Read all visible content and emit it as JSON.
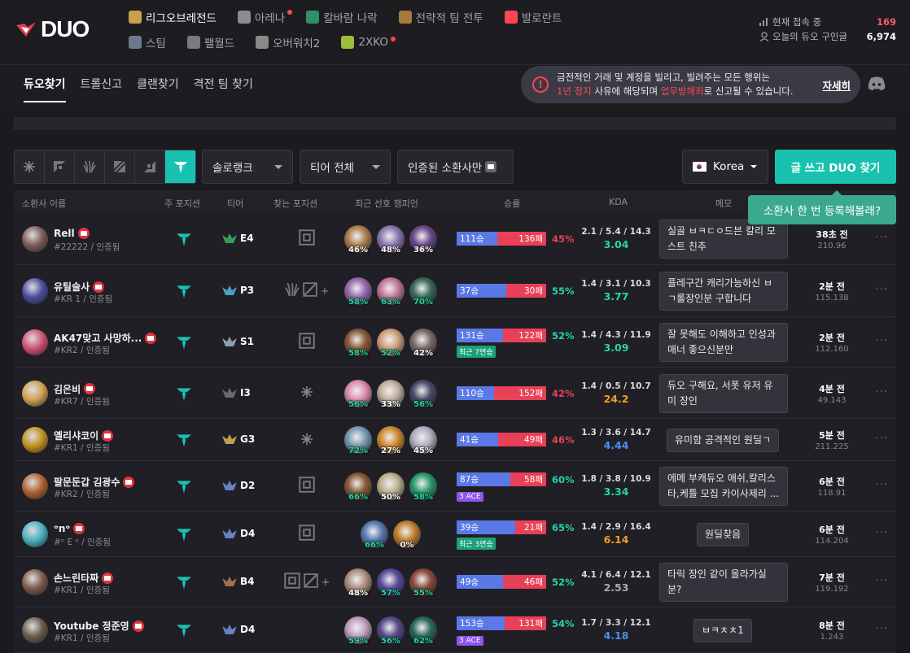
{
  "brand": {
    "logo": "DUO"
  },
  "games": [
    [
      {
        "label": "리그오브레전드",
        "color": "#c8a24a",
        "active": true,
        "dot": false
      },
      {
        "label": "아레나",
        "color": "#8c8c8c",
        "active": false,
        "dot": true
      },
      {
        "label": "칼바람 나락",
        "color": "#2f8f6a",
        "active": false,
        "dot": false
      },
      {
        "label": "전략적 팀 전투",
        "color": "#a57b3c",
        "active": false,
        "dot": false
      },
      {
        "label": "발로란트",
        "color": "#ff4655",
        "active": false,
        "dot": false
      }
    ],
    [
      {
        "label": "스팀",
        "color": "#6c7a8f",
        "active": false,
        "dot": false
      },
      {
        "label": "팰월드",
        "color": "#7a7a7a",
        "active": false,
        "dot": false
      },
      {
        "label": "오버워치2",
        "color": "#8a8a8a",
        "active": false,
        "dot": false
      },
      {
        "label": "2XKO",
        "color": "#9bbf3a",
        "active": false,
        "dot": true
      }
    ]
  ],
  "stats": {
    "now_label": "현재 접속 중",
    "now_value": "169",
    "today_label": "오늘의 듀오 구인글",
    "today_value": "6,974"
  },
  "tabs": [
    "듀오찾기",
    "트롤신고",
    "클랜찾기",
    "격전 팀 찾기"
  ],
  "notice": {
    "line1": "금전적인 거래 및 계정을 빌리고, 빌려주는 모든 행위는",
    "red1": "1년 정지",
    "mid": " 사유에 해당되며 ",
    "red2": "업무방해죄",
    "end": "로 신고될 수 있습니다.",
    "more": "자세히"
  },
  "filters": {
    "queue": "솔로랭크",
    "tier": "티어 전체",
    "verified": "인증된 소환사만",
    "region": "Korea",
    "write": "글 쓰고 DUO 찾기"
  },
  "tooltip": "소환사 한 번 등록해볼래?",
  "headers": {
    "name": "소환사 이름",
    "main": "주 포지션",
    "tier": "티어",
    "find": "찾는 포지션",
    "champs": "최근 선호 챔피언",
    "wr": "승률",
    "kda": "KDA",
    "memo": "메모"
  },
  "rows": [
    {
      "name": "Rell",
      "tag": "#22222 / 인증됨",
      "av": "#7c5a5a",
      "tier": "E4",
      "tc": "#3a9e5a",
      "find": "mid",
      "champs": [
        {
          "c": "#b08050",
          "p": "46%",
          "g": false
        },
        {
          "c": "#8a7ab0",
          "p": "48%",
          "g": false
        },
        {
          "c": "#6a4a8a",
          "p": "36%",
          "g": false
        }
      ],
      "w": "111승",
      "l": "136패",
      "wp": 0.45,
      "pct": "45%",
      "tags": [],
      "kda": "2.1 / 5.4 / 14.3",
      "k": "3.04",
      "kc": "#27d7a0",
      "memo": "실골 ㅂㅋㄷㅇ드븐 칼리 모스트 친추",
      "time": "38초 전",
      "sub": "210.96"
    },
    {
      "name": "유틸술사",
      "tag": "#KR 1 / 인증됨",
      "av": "#4a4aa0",
      "tier": "P3",
      "tc": "#4aa0c0",
      "find": "multi",
      "champs": [
        {
          "c": "#9a6ab0",
          "p": "58%",
          "g": true
        },
        {
          "c": "#c07a9a",
          "p": "63%",
          "g": true
        },
        {
          "c": "#3a6a5a",
          "p": "70%",
          "g": true
        }
      ],
      "w": "37승",
      "l": "30패",
      "wp": 0.55,
      "pct": "55%",
      "tags": [],
      "kda": "1.4 / 3.1 / 10.3",
      "k": "3.77",
      "kc": "#27d7a0",
      "memo": "플레구간 캐리가능하신 ㅂㄱ롤장인분 구합니다",
      "time": "2분 전",
      "sub": "115.138"
    },
    {
      "name": "AK47맞고 사망하...",
      "tag": "#KR2 / 인증됨",
      "av": "#d05070",
      "tier": "S1",
      "tc": "#8ca0b0",
      "find": "mid",
      "champs": [
        {
          "c": "#8a5a3a",
          "p": "58%",
          "g": true
        },
        {
          "c": "#d0a080",
          "p": "52%",
          "g": true
        },
        {
          "c": "#7a6a6a",
          "p": "42%",
          "g": false
        }
      ],
      "w": "131승",
      "l": "122패",
      "wp": 0.52,
      "pct": "52%",
      "tags": [
        {
          "t": "최근 7연승",
          "k": "streak"
        }
      ],
      "kda": "1.4 / 4.3 / 11.9",
      "k": "3.09",
      "kc": "#27d7a0",
      "memo": "잘 못해도 이해하고 인성과 매너 좋으신분만",
      "time": "2분 전",
      "sub": "112.160"
    },
    {
      "name": "김은비",
      "tag": "#KR7 / 인증됨",
      "av": "#d0a050",
      "tier": "I3",
      "tc": "#6a6a70",
      "find": "all",
      "champs": [
        {
          "c": "#e090b0",
          "p": "56%",
          "g": true
        },
        {
          "c": "#c0b0a0",
          "p": "33%",
          "g": false
        },
        {
          "c": "#4a4a6a",
          "p": "56%",
          "g": true
        }
      ],
      "w": "110승",
      "l": "152패",
      "wp": 0.42,
      "pct": "42%",
      "tags": [],
      "kda": "1.4 / 0.5 / 10.7",
      "k": "24.2",
      "kc": "#f0a020",
      "memo": "듀오 구해요, 서폿 유저 유미 장인",
      "time": "4분 전",
      "sub": "49.143"
    },
    {
      "name": "옐리샤코이",
      "tag": "#KR1 / 인증됨",
      "av": "#c09020",
      "tier": "G3",
      "tc": "#c0a050",
      "find": "all",
      "champs": [
        {
          "c": "#7a9ab0",
          "p": "72%",
          "g": true
        },
        {
          "c": "#d08a30",
          "p": "27%",
          "g": false
        },
        {
          "c": "#b0b0c0",
          "p": "45%",
          "g": false
        }
      ],
      "w": "41승",
      "l": "49패",
      "wp": 0.46,
      "pct": "46%",
      "tags": [],
      "kda": "1.3 / 3.6 / 14.7",
      "k": "4.44",
      "kc": "#4a90f0",
      "memo": "유미함 공격적인 원딜ㄱ",
      "time": "5분 전",
      "sub": "211.225"
    },
    {
      "name": "팔문둔갑 김광수",
      "tag": "#KR2 / 인증됨",
      "av": "#b06030",
      "tier": "D2",
      "tc": "#6a80c0",
      "find": "mid",
      "champs": [
        {
          "c": "#8a5a3a",
          "p": "66%",
          "g": true
        },
        {
          "c": "#c0b090",
          "p": "50%",
          "g": false
        },
        {
          "c": "#2a9a6a",
          "p": "58%",
          "g": true
        }
      ],
      "w": "87승",
      "l": "58패",
      "wp": 0.6,
      "pct": "60%",
      "tags": [
        {
          "t": "3 ACE",
          "k": "ace"
        }
      ],
      "kda": "1.8 / 3.8 / 10.9",
      "k": "3.34",
      "kc": "#27d7a0",
      "memo": "에메 부캐듀오 애쉬,칼리스타,케틀 모집 카이사제리 ...",
      "time": "6분 전",
      "sub": "118.91"
    },
    {
      "name": "ᵒnᵒ",
      "tag": "#ᵒ E ᵒ / 인증됨",
      "av": "#4ab0c0",
      "tier": "D4",
      "tc": "#6a80c0",
      "find": "mid",
      "champs": [
        {
          "c": "#5a7ab0",
          "p": "66%",
          "g": true
        },
        {
          "c": "#c08030",
          "p": "0%",
          "g": false
        }
      ],
      "w": "39승",
      "l": "21패",
      "wp": 0.65,
      "pct": "65%",
      "tags": [
        {
          "t": "최근 3연승",
          "k": "streak"
        }
      ],
      "kda": "1.4 / 2.9 / 16.4",
      "k": "6.14",
      "kc": "#f0a020",
      "memo": "원딜찾음",
      "time": "6분 전",
      "sub": "114.204"
    },
    {
      "name": "손느린타짜",
      "tag": "#KR1 / 인증됨",
      "av": "#7a5a4a",
      "tier": "B4",
      "tc": "#a07050",
      "find": "multi2",
      "champs": [
        {
          "c": "#b09080",
          "p": "48%",
          "g": false
        },
        {
          "c": "#5a4a9a",
          "p": "57%",
          "g": true
        },
        {
          "c": "#8a4a3a",
          "p": "55%",
          "g": true
        }
      ],
      "w": "49승",
      "l": "46패",
      "wp": 0.52,
      "pct": "52%",
      "tags": [],
      "kda": "4.1 / 6.4 / 12.1",
      "k": "2.53",
      "kc": "#aaaaaa",
      "memo": "타릭 장인 같이 올라가실 분?",
      "time": "7분 전",
      "sub": "119.192"
    },
    {
      "name": "Youtube 정준영",
      "tag": "#KR1 / 인증됨",
      "av": "#6a5a4a",
      "tier": "D4",
      "tc": "#6a80c0",
      "find": "none",
      "champs": [
        {
          "c": "#c0a0c0",
          "p": "59%",
          "g": true
        },
        {
          "c": "#5a4a8a",
          "p": "56%",
          "g": true
        },
        {
          "c": "#2a6a5a",
          "p": "62%",
          "g": true
        }
      ],
      "w": "153승",
      "l": "131패",
      "wp": 0.54,
      "pct": "54%",
      "tags": [
        {
          "t": "3 ACE",
          "k": "ace"
        }
      ],
      "kda": "1.7 / 3.3 / 12.1",
      "k": "4.18",
      "kc": "#4a90f0",
      "memo": "ㅂㅋㅊㅊ1",
      "time": "8분 전",
      "sub": "1.243"
    }
  ]
}
